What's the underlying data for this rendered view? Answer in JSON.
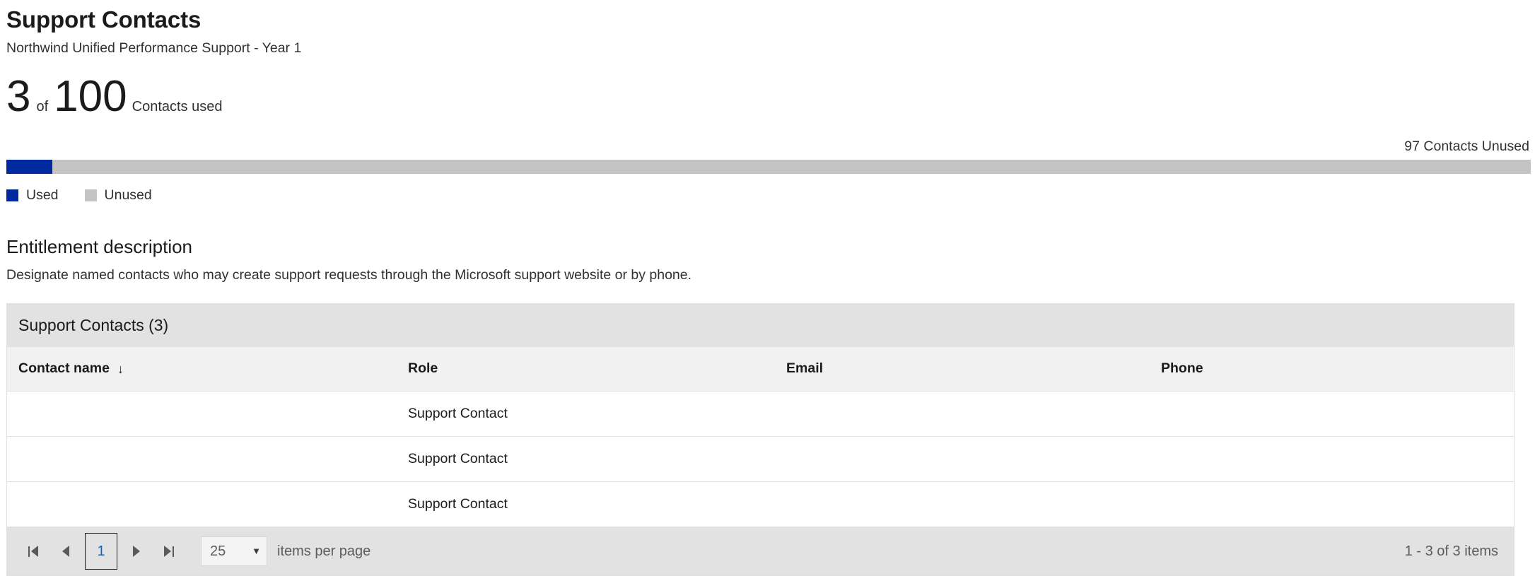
{
  "header": {
    "title": "Support Contacts",
    "subtitle": "Northwind Unified Performance Support - Year 1"
  },
  "usage": {
    "used": "3",
    "of_label": "of",
    "total": "100",
    "caption": "Contacts used",
    "unused_label": "97 Contacts Unused",
    "used_percent": 3,
    "used_color": "#002a9e",
    "unused_color": "#c4c4c4"
  },
  "legend": {
    "items": [
      {
        "label": "Used",
        "color": "#002a9e"
      },
      {
        "label": "Unused",
        "color": "#c4c4c4"
      }
    ]
  },
  "entitlement": {
    "title": "Entitlement description",
    "description": "Designate named contacts who may create support requests through the Microsoft support website or by phone."
  },
  "grid": {
    "toolbar_title": "Support Contacts (3)",
    "columns": [
      {
        "key": "name",
        "label": "Contact name",
        "sorted": true,
        "sort_arrow": "↓"
      },
      {
        "key": "role",
        "label": "Role",
        "sorted": false
      },
      {
        "key": "email",
        "label": "Email",
        "sorted": false
      },
      {
        "key": "phone",
        "label": "Phone",
        "sorted": false
      }
    ],
    "rows": [
      {
        "name": "",
        "role": "Support Contact",
        "email": "",
        "phone": ""
      },
      {
        "name": "",
        "role": "Support Contact",
        "email": "",
        "phone": ""
      },
      {
        "name": "",
        "role": "Support Contact",
        "email": "",
        "phone": ""
      }
    ]
  },
  "pager": {
    "first_icon": "first-page-icon",
    "prev_icon": "previous-page-icon",
    "next_icon": "next-page-icon",
    "last_icon": "last-page-icon",
    "current_page": "1",
    "page_size": "25",
    "page_size_options": [
      "25"
    ],
    "items_per_page_label": "items per page",
    "summary": "1 - 3 of 3 items"
  }
}
